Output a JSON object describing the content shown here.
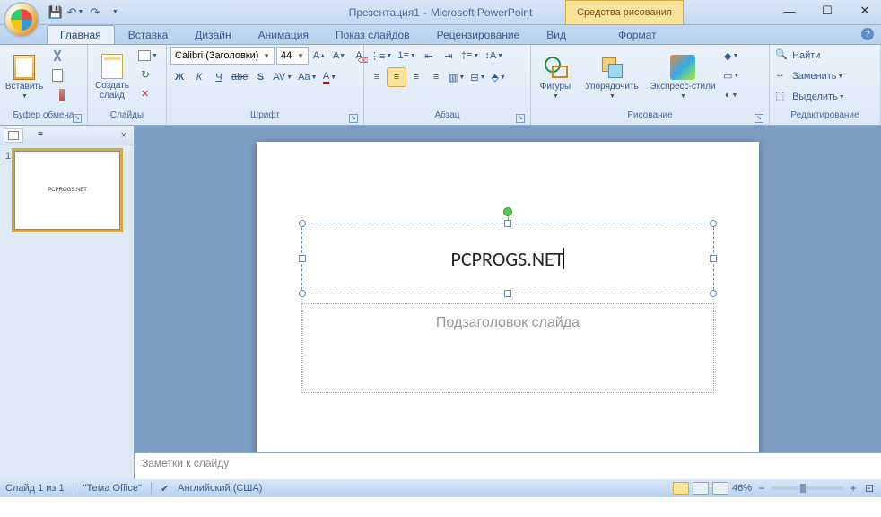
{
  "titlebar": {
    "doc_title": "Презентация1",
    "app_name": "Microsoft PowerPoint",
    "tool_context": "Средства рисования"
  },
  "tabs": {
    "items": [
      "Главная",
      "Вставка",
      "Дизайн",
      "Анимация",
      "Показ слайдов",
      "Рецензирование",
      "Вид"
    ],
    "contextual": "Формат",
    "active": 0
  },
  "ribbon": {
    "clipboard": {
      "label": "Буфер обмена",
      "paste": "Вставить"
    },
    "slides": {
      "label": "Слайды",
      "new_slide": "Создать\nслайд"
    },
    "font": {
      "label": "Шрифт",
      "name": "Calibri (Заголовки)",
      "size": "44",
      "bold": "Ж",
      "italic": "К",
      "underline": "Ч",
      "strike": "abe",
      "shadow": "S"
    },
    "paragraph": {
      "label": "Абзац"
    },
    "drawing": {
      "label": "Рисование",
      "shapes": "Фигуры",
      "arrange": "Упорядочить",
      "styles": "Экспресс-стили"
    },
    "editing": {
      "label": "Редактирование",
      "find": "Найти",
      "replace": "Заменить",
      "select": "Выделить"
    }
  },
  "slide": {
    "title_text": "PCPROGS.NET",
    "subtitle_placeholder": "Подзаголовок слайда",
    "thumb_text": "PCPROGS.NET",
    "thumb_number": "1"
  },
  "notes": {
    "placeholder": "Заметки к слайду"
  },
  "status": {
    "slide_counter": "Слайд 1 из 1",
    "theme": "\"Тема Office\"",
    "language": "Английский (США)",
    "zoom": "46%"
  }
}
